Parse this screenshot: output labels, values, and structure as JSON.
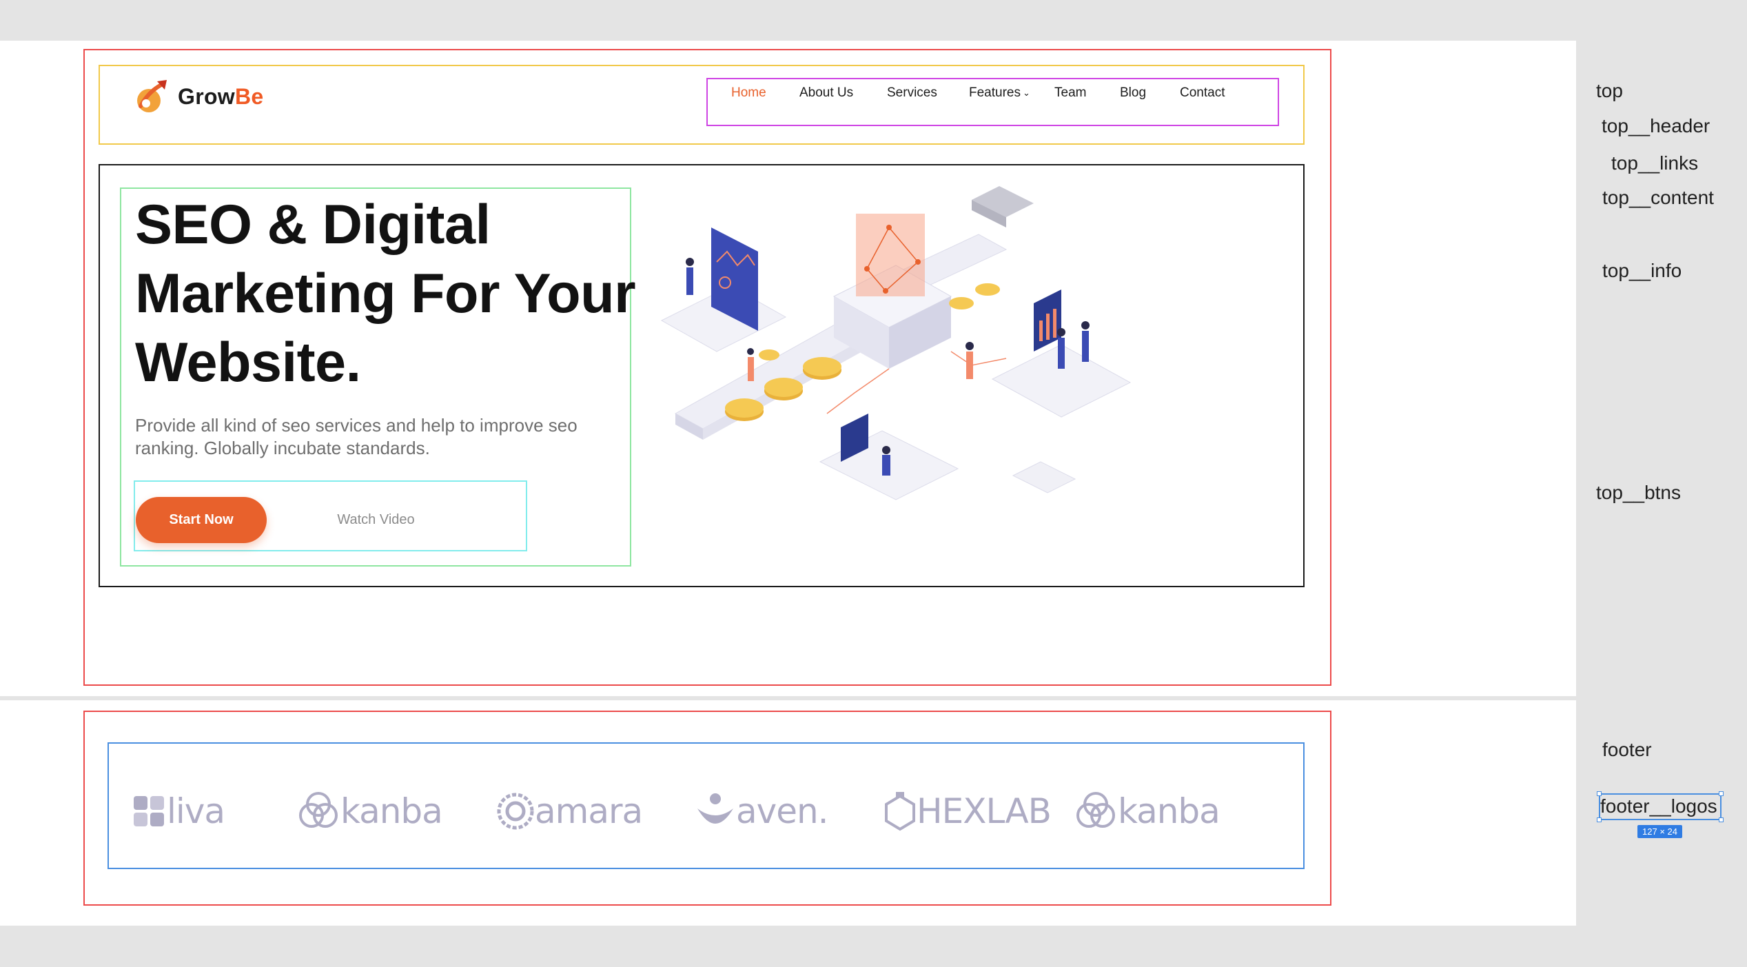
{
  "brand": {
    "name_part1": "Grow",
    "name_part2": "Be",
    "accent": "#f05a24"
  },
  "nav": {
    "items": [
      {
        "label": "Home",
        "active": true
      },
      {
        "label": "About Us"
      },
      {
        "label": "Services"
      },
      {
        "label": "Features",
        "has_dropdown": true
      },
      {
        "label": "Team"
      },
      {
        "label": "Blog"
      },
      {
        "label": "Contact"
      }
    ]
  },
  "hero": {
    "title_lines": [
      "SEO & Digital",
      "Marketing For Your",
      "Website."
    ],
    "description": "Provide all kind of seo services and help to improve seo ranking. Globally incubate standards.",
    "primary_button": "Start Now",
    "secondary_button": "Watch Video"
  },
  "footer": {
    "logos": [
      "liva",
      "kanba",
      "amara",
      "aven.",
      "HEXLAB",
      "kanba"
    ]
  },
  "layer_panel": {
    "labels": [
      "top",
      "top__header",
      "top__links",
      "top__content",
      "top__info",
      "top__btns",
      "footer",
      "footer__logos"
    ],
    "selection_size": "127 × 24"
  },
  "colors": {
    "accent": "#e8612c",
    "logo_gray": "#aeacc4",
    "frame_red": "#ec4a4a"
  }
}
